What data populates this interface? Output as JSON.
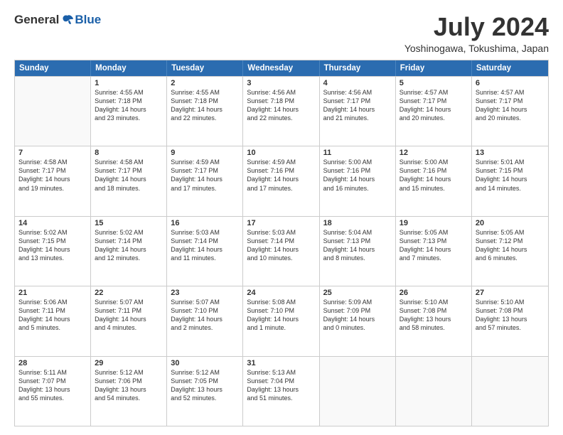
{
  "logo": {
    "general": "General",
    "blue": "Blue"
  },
  "title": "July 2024",
  "location": "Yoshinogawa, Tokushima, Japan",
  "weekdays": [
    "Sunday",
    "Monday",
    "Tuesday",
    "Wednesday",
    "Thursday",
    "Friday",
    "Saturday"
  ],
  "weeks": [
    [
      {
        "day": "",
        "info": ""
      },
      {
        "day": "1",
        "info": "Sunrise: 4:55 AM\nSunset: 7:18 PM\nDaylight: 14 hours\nand 23 minutes."
      },
      {
        "day": "2",
        "info": "Sunrise: 4:55 AM\nSunset: 7:18 PM\nDaylight: 14 hours\nand 22 minutes."
      },
      {
        "day": "3",
        "info": "Sunrise: 4:56 AM\nSunset: 7:18 PM\nDaylight: 14 hours\nand 22 minutes."
      },
      {
        "day": "4",
        "info": "Sunrise: 4:56 AM\nSunset: 7:17 PM\nDaylight: 14 hours\nand 21 minutes."
      },
      {
        "day": "5",
        "info": "Sunrise: 4:57 AM\nSunset: 7:17 PM\nDaylight: 14 hours\nand 20 minutes."
      },
      {
        "day": "6",
        "info": "Sunrise: 4:57 AM\nSunset: 7:17 PM\nDaylight: 14 hours\nand 20 minutes."
      }
    ],
    [
      {
        "day": "7",
        "info": "Sunrise: 4:58 AM\nSunset: 7:17 PM\nDaylight: 14 hours\nand 19 minutes."
      },
      {
        "day": "8",
        "info": "Sunrise: 4:58 AM\nSunset: 7:17 PM\nDaylight: 14 hours\nand 18 minutes."
      },
      {
        "day": "9",
        "info": "Sunrise: 4:59 AM\nSunset: 7:17 PM\nDaylight: 14 hours\nand 17 minutes."
      },
      {
        "day": "10",
        "info": "Sunrise: 4:59 AM\nSunset: 7:16 PM\nDaylight: 14 hours\nand 17 minutes."
      },
      {
        "day": "11",
        "info": "Sunrise: 5:00 AM\nSunset: 7:16 PM\nDaylight: 14 hours\nand 16 minutes."
      },
      {
        "day": "12",
        "info": "Sunrise: 5:00 AM\nSunset: 7:16 PM\nDaylight: 14 hours\nand 15 minutes."
      },
      {
        "day": "13",
        "info": "Sunrise: 5:01 AM\nSunset: 7:15 PM\nDaylight: 14 hours\nand 14 minutes."
      }
    ],
    [
      {
        "day": "14",
        "info": "Sunrise: 5:02 AM\nSunset: 7:15 PM\nDaylight: 14 hours\nand 13 minutes."
      },
      {
        "day": "15",
        "info": "Sunrise: 5:02 AM\nSunset: 7:14 PM\nDaylight: 14 hours\nand 12 minutes."
      },
      {
        "day": "16",
        "info": "Sunrise: 5:03 AM\nSunset: 7:14 PM\nDaylight: 14 hours\nand 11 minutes."
      },
      {
        "day": "17",
        "info": "Sunrise: 5:03 AM\nSunset: 7:14 PM\nDaylight: 14 hours\nand 10 minutes."
      },
      {
        "day": "18",
        "info": "Sunrise: 5:04 AM\nSunset: 7:13 PM\nDaylight: 14 hours\nand 8 minutes."
      },
      {
        "day": "19",
        "info": "Sunrise: 5:05 AM\nSunset: 7:13 PM\nDaylight: 14 hours\nand 7 minutes."
      },
      {
        "day": "20",
        "info": "Sunrise: 5:05 AM\nSunset: 7:12 PM\nDaylight: 14 hours\nand 6 minutes."
      }
    ],
    [
      {
        "day": "21",
        "info": "Sunrise: 5:06 AM\nSunset: 7:11 PM\nDaylight: 14 hours\nand 5 minutes."
      },
      {
        "day": "22",
        "info": "Sunrise: 5:07 AM\nSunset: 7:11 PM\nDaylight: 14 hours\nand 4 minutes."
      },
      {
        "day": "23",
        "info": "Sunrise: 5:07 AM\nSunset: 7:10 PM\nDaylight: 14 hours\nand 2 minutes."
      },
      {
        "day": "24",
        "info": "Sunrise: 5:08 AM\nSunset: 7:10 PM\nDaylight: 14 hours\nand 1 minute."
      },
      {
        "day": "25",
        "info": "Sunrise: 5:09 AM\nSunset: 7:09 PM\nDaylight: 14 hours\nand 0 minutes."
      },
      {
        "day": "26",
        "info": "Sunrise: 5:10 AM\nSunset: 7:08 PM\nDaylight: 13 hours\nand 58 minutes."
      },
      {
        "day": "27",
        "info": "Sunrise: 5:10 AM\nSunset: 7:08 PM\nDaylight: 13 hours\nand 57 minutes."
      }
    ],
    [
      {
        "day": "28",
        "info": "Sunrise: 5:11 AM\nSunset: 7:07 PM\nDaylight: 13 hours\nand 55 minutes."
      },
      {
        "day": "29",
        "info": "Sunrise: 5:12 AM\nSunset: 7:06 PM\nDaylight: 13 hours\nand 54 minutes."
      },
      {
        "day": "30",
        "info": "Sunrise: 5:12 AM\nSunset: 7:05 PM\nDaylight: 13 hours\nand 52 minutes."
      },
      {
        "day": "31",
        "info": "Sunrise: 5:13 AM\nSunset: 7:04 PM\nDaylight: 13 hours\nand 51 minutes."
      },
      {
        "day": "",
        "info": ""
      },
      {
        "day": "",
        "info": ""
      },
      {
        "day": "",
        "info": ""
      }
    ]
  ]
}
